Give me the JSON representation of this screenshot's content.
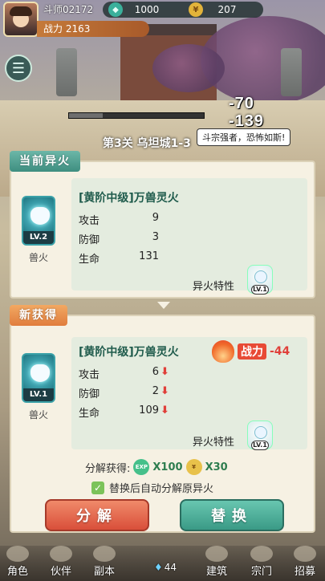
{
  "header": {
    "player_name": "斗师02172",
    "gems": "1000",
    "coins": "207",
    "power_label": "战力 2163",
    "menu_icon": "list-icon"
  },
  "battle": {
    "damage_1": "-70",
    "damage_2": "-139",
    "enemy_speech": "斗宗强者，恐怖如斯!",
    "stage_title": "第3关 乌坦城1-3"
  },
  "current_fire": {
    "section_label": "当前异火",
    "name": "[黄阶中级]万兽灵火",
    "level": "LV.2",
    "card_label": "兽火",
    "stats": [
      {
        "key": "攻击",
        "value": "9"
      },
      {
        "key": "防御",
        "value": "3"
      },
      {
        "key": "生命",
        "value": "131"
      }
    ],
    "trait_label": "异火特性",
    "trait_level": "LV.1"
  },
  "new_fire": {
    "section_label": "新获得",
    "name": "[黄阶中级]万兽灵火",
    "level": "LV.1",
    "card_label": "兽火",
    "power_label": "战力",
    "power_change": "-44",
    "stats": [
      {
        "key": "攻击",
        "value": "6"
      },
      {
        "key": "防御",
        "value": "2"
      },
      {
        "key": "生命",
        "value": "109"
      }
    ],
    "trait_label": "异火特性",
    "trait_level": "LV.1",
    "decompose_gain_label": "分解获得:",
    "exp_badge": "EXP",
    "exp_reward": "X100",
    "gold_reward": "X30",
    "auto_decompose_label": "替换后自动分解原异火",
    "decompose_button": "分解",
    "replace_button": "替换"
  },
  "bottom_nav": {
    "items": [
      "角色",
      "伙伴",
      "副本",
      "建筑",
      "宗门",
      "招募"
    ],
    "center_value": "44"
  },
  "colors": {
    "accent_green": "#3e8e80",
    "accent_orange": "#e07d3d",
    "decrease_red": "#e0403a"
  }
}
